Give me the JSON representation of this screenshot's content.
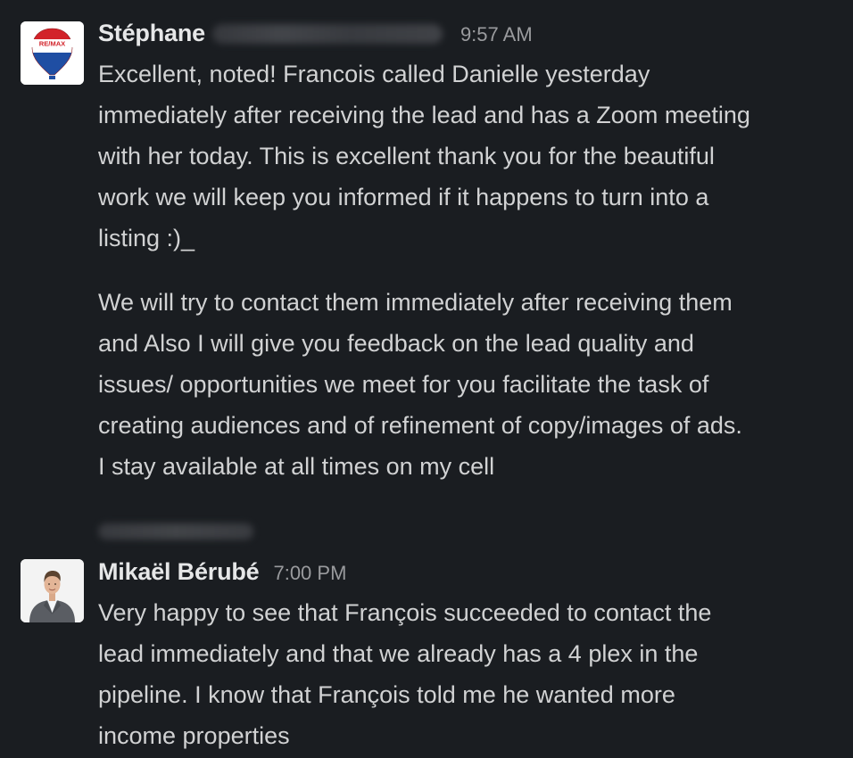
{
  "messages": [
    {
      "sender": "Stéphane",
      "time": "9:57 AM",
      "avatar": {
        "icon": "remax-balloon-logo-icon",
        "logo_text": "RE/MAX",
        "colors": {
          "red": "#d2232a",
          "blue": "#1f4ea3",
          "white": "#ffffff"
        }
      },
      "paragraphs": [
        "Excellent, noted! Francois called Danielle yesterday\nimmediately after receiving the lead and has a Zoom meeting\nwith her today. This is excellent thank you for the beautiful\nwork we will keep you informed if it happens to turn into a\nlisting :)_",
        "We will try to contact them immediately after receiving them\nand Also I will give you feedback on the lead quality and\nissues/ opportunities we meet for you facilitate the task of\ncreating audiences and of refinement of copy/images of ads.\nI stay available at all times on my cell"
      ]
    },
    {
      "sender": "Mikaël Bérubé",
      "time": "7:00 PM",
      "avatar": {
        "icon": "person-photo-avatar"
      },
      "paragraphs": [
        "Very happy to see that François succeeded to contact the\nlead immediately and that we already has a 4 plex in the\npipeline. I know that François told me he wanted more\nincome properties"
      ]
    }
  ],
  "colors": {
    "background": "#1a1d21",
    "text": "#d1d2d3",
    "sender": "#e6e7e8",
    "timestamp": "#9a9b9e"
  }
}
